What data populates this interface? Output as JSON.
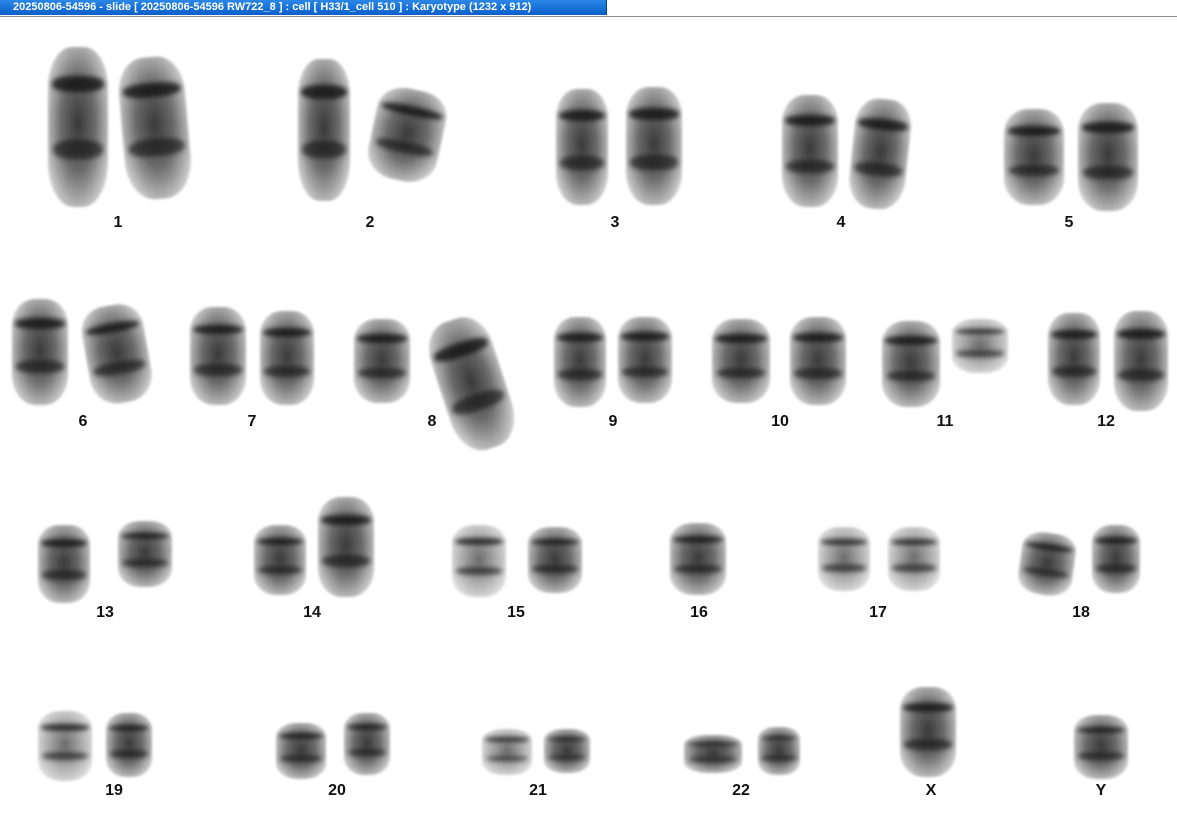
{
  "window": {
    "title": "20250806-54596 - slide [ 20250806-54596 RW722_8 ] : cell [ H33/1_cell 510 ] : Karyotype  (1232 x 912)"
  },
  "karyotype": {
    "labels": {
      "c1": "1",
      "c2": "2",
      "c3": "3",
      "c4": "4",
      "c5": "5",
      "c6": "6",
      "c7": "7",
      "c8": "8",
      "c9": "9",
      "c10": "10",
      "c11": "11",
      "c12": "12",
      "c13": "13",
      "c14": "14",
      "c15": "15",
      "c16": "16",
      "c17": "17",
      "c18": "18",
      "c19": "19",
      "c20": "20",
      "c21": "21",
      "c22": "22",
      "cX": "X",
      "cY": "Y"
    }
  }
}
